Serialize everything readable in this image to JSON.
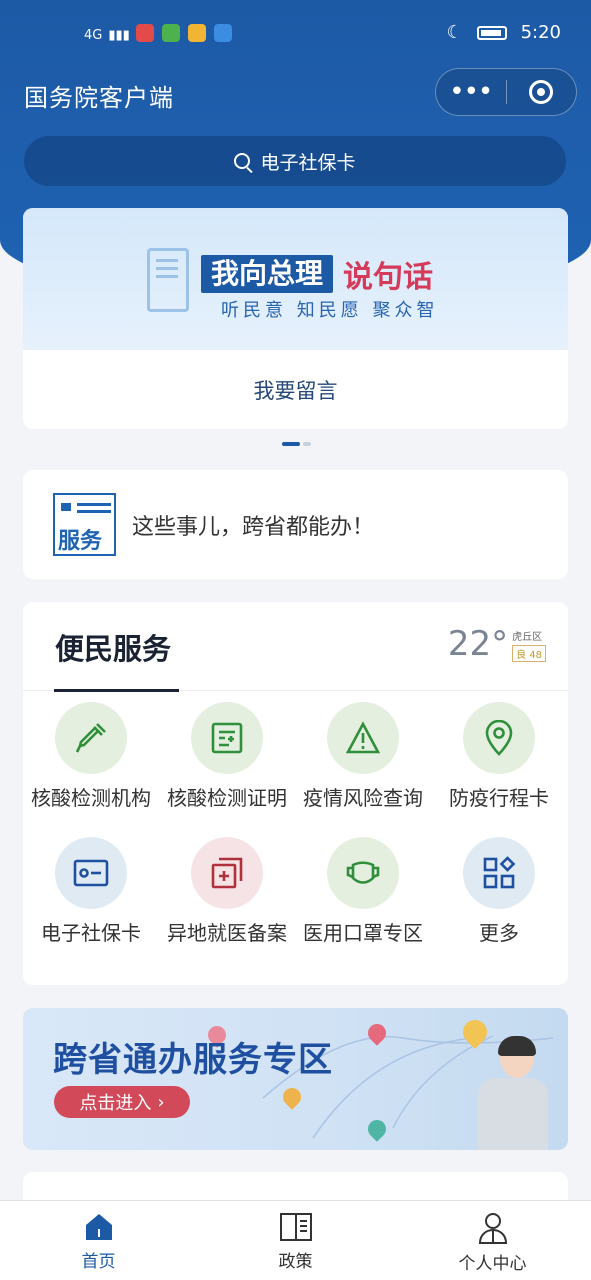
{
  "status_bar": {
    "time": "5:20",
    "network_label": "4G"
  },
  "header": {
    "app_title": "国务院客户端"
  },
  "search": {
    "placeholder": "电子社保卡"
  },
  "banner": {
    "headline_box": "我向总理",
    "headline_red": "说句话",
    "subline": "听民意  知民愿  聚众智",
    "action": "我要留言"
  },
  "service_card": {
    "badge": "服务",
    "text": "这些事儿，跨省都能办！"
  },
  "convenience": {
    "title": "便民服务",
    "weather": {
      "temp": "22°",
      "district": "虎丘区",
      "aqi": "良 48"
    },
    "items": [
      {
        "label": "核酸检测机构",
        "icon": "dropper-icon"
      },
      {
        "label": "核酸检测证明",
        "icon": "certificate-icon"
      },
      {
        "label": "疫情风险查询",
        "icon": "warning-icon"
      },
      {
        "label": "防疫行程卡",
        "icon": "location-icon"
      },
      {
        "label": "电子社保卡",
        "icon": "id-card-icon"
      },
      {
        "label": "异地就医备案",
        "icon": "medical-record-icon"
      },
      {
        "label": "医用口罩专区",
        "icon": "mask-icon"
      },
      {
        "label": "更多",
        "icon": "grid-more-icon"
      }
    ]
  },
  "promo": {
    "title": "跨省通办服务专区",
    "button": "点击进入"
  },
  "tabbar": {
    "items": [
      {
        "label": "首页",
        "icon": "home-icon",
        "active": true
      },
      {
        "label": "政策",
        "icon": "book-icon",
        "active": false
      },
      {
        "label": "个人中心",
        "icon": "user-icon",
        "active": false
      }
    ]
  },
  "colors": {
    "brand": "#1d5aa6",
    "accent_red": "#d63a5a",
    "icon_green": "#2f8f3a",
    "icon_blue": "#1f4fa0",
    "icon_red": "#b0303c"
  }
}
